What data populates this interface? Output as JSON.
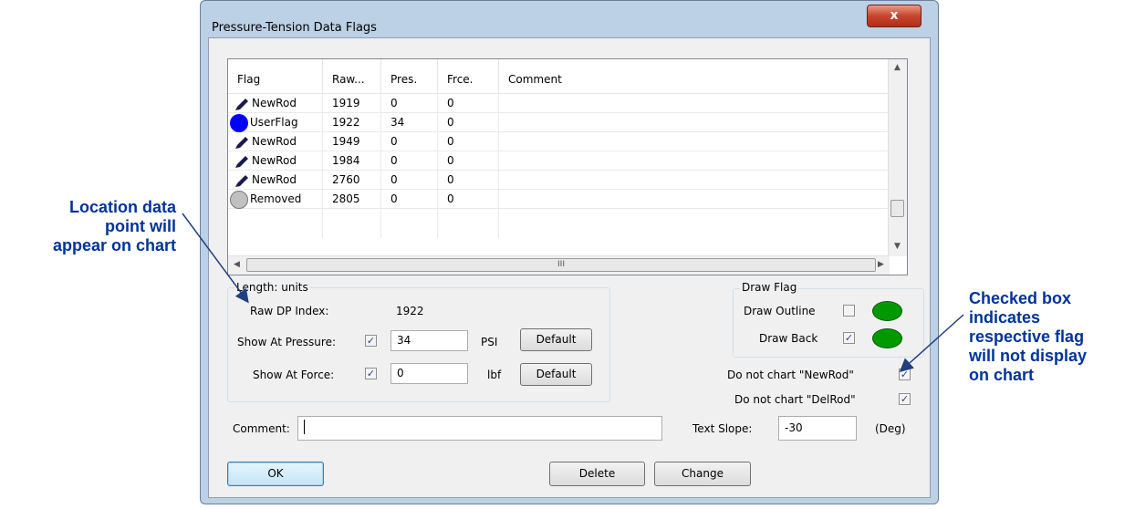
{
  "dialog": {
    "title": "Pressure-Tension Data Flags",
    "close_label": "x"
  },
  "grid": {
    "columns": [
      "Flag",
      "Raw...",
      "Pres.",
      "Frce.",
      "Comment"
    ],
    "rows": [
      {
        "icon": "pen-icon",
        "flag": "NewRod",
        "raw": "1919",
        "pres": "0",
        "frce": "0",
        "comment": ""
      },
      {
        "icon": "blue-circle-icon",
        "flag": "UserFlag",
        "raw": "1922",
        "pres": "34",
        "frce": "0",
        "comment": ""
      },
      {
        "icon": "pen-icon",
        "flag": "NewRod",
        "raw": "1949",
        "pres": "0",
        "frce": "0",
        "comment": ""
      },
      {
        "icon": "pen-icon",
        "flag": "NewRod",
        "raw": "1984",
        "pres": "0",
        "frce": "0",
        "comment": ""
      },
      {
        "icon": "pen-icon",
        "flag": "NewRod",
        "raw": "2760",
        "pres": "0",
        "frce": "0",
        "comment": ""
      },
      {
        "icon": "gray-circle-icon",
        "flag": "Removed",
        "raw": "2805",
        "pres": "0",
        "frce": "0",
        "comment": ""
      }
    ],
    "hscroll_grip": "III"
  },
  "length_group": {
    "label": "Length: units",
    "raw_dp_label": "Raw DP Index:",
    "raw_dp_value": "1922",
    "pressure_label": "Show At Pressure:",
    "pressure_checked": true,
    "pressure_value": "34",
    "pressure_unit": "PSI",
    "force_label": "Show At Force:",
    "force_checked": true,
    "force_value": "0",
    "force_unit": "lbf",
    "default_label": "Default"
  },
  "draw_flag": {
    "label": "Draw Flag",
    "outline_label": "Draw Outline",
    "outline_checked": false,
    "back_label": "Draw Back",
    "back_checked": true,
    "color": "#009900"
  },
  "chart_options": {
    "newrod_label": "Do not chart \"NewRod\"",
    "newrod_checked": true,
    "delrod_label": "Do not chart \"DelRod\"",
    "delrod_checked": true
  },
  "comment": {
    "label": "Comment:",
    "value": ""
  },
  "text_slope": {
    "label": "Text Slope:",
    "value": "-30",
    "unit": "(Deg)"
  },
  "buttons": {
    "ok": "OK",
    "delete": "Delete",
    "change": "Change"
  },
  "annotations": {
    "left": [
      "Location data",
      "point will",
      "appear on chart"
    ],
    "right": [
      "Checked box",
      "indicates",
      "respective flag",
      "will not display",
      "on chart"
    ]
  },
  "colors": {
    "annotation": "#003399",
    "check": "#27448c",
    "user_flag": "#0000ff",
    "removed_flag": "#c0c0c0"
  }
}
